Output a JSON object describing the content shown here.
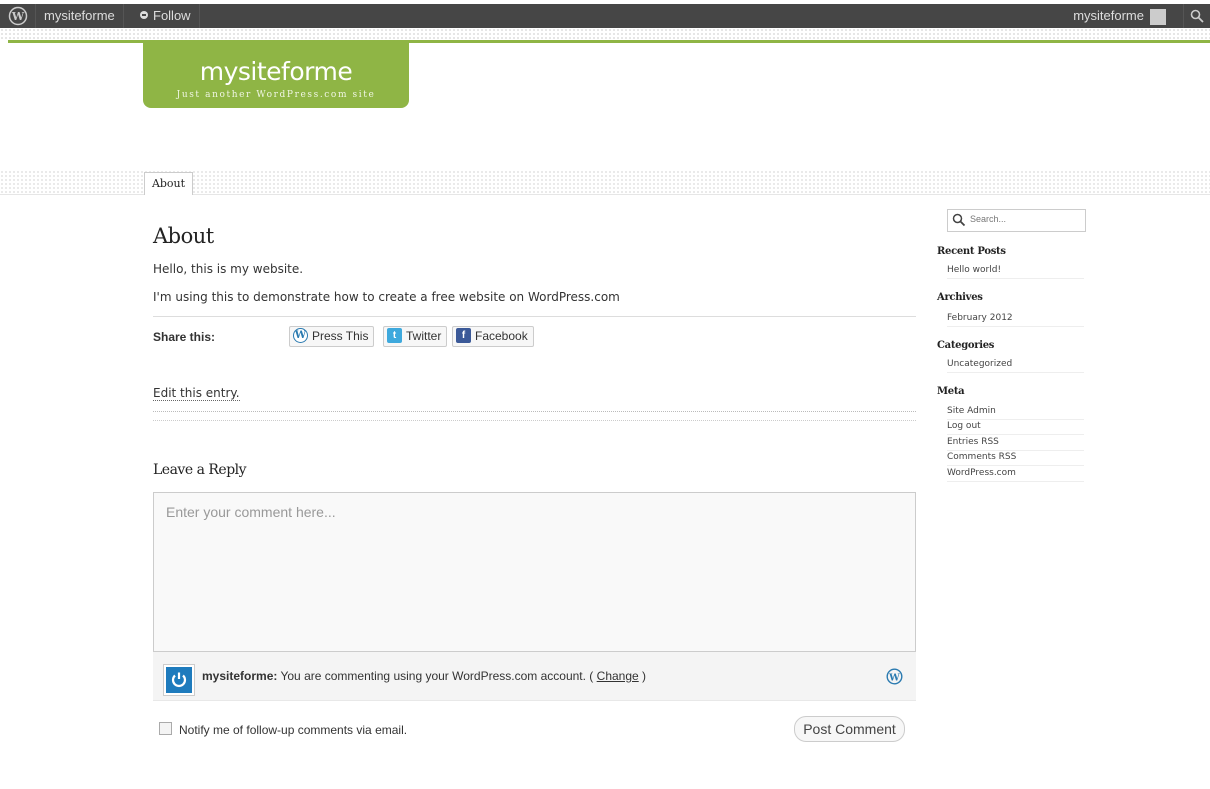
{
  "adminbar": {
    "site_name": "mysiteforme",
    "follow_label": "Follow",
    "user_name": "mysiteforme"
  },
  "header": {
    "title": "mysiteforme",
    "tagline": "Just another WordPress.com site"
  },
  "nav": {
    "tabs": [
      {
        "label": "About"
      }
    ]
  },
  "page": {
    "title": "About",
    "paragraphs": [
      "Hello, this is my website.",
      "I'm using this to demonstrate how to create a free website on WordPress.com"
    ]
  },
  "share": {
    "label": "Share this:",
    "buttons": [
      {
        "label": "Press This",
        "icon": "wordpress-icon"
      },
      {
        "label": "Twitter",
        "icon": "twitter-icon"
      },
      {
        "label": "Facebook",
        "icon": "facebook-icon"
      }
    ]
  },
  "edit_link": "Edit this entry.",
  "reply": {
    "title": "Leave a Reply",
    "placeholder": "Enter your comment here...",
    "identity_name": "mysiteforme:",
    "identity_text": "You are commenting using your WordPress.com account. (",
    "change_label": "Change",
    "identity_close": ")",
    "notify_label": "Notify me of follow-up comments via email.",
    "post_button": "Post Comment"
  },
  "sidebar": {
    "search_placeholder": "Search...",
    "widgets": [
      {
        "title": "Recent Posts",
        "items": [
          "Hello world!"
        ]
      },
      {
        "title": "Archives",
        "items": [
          "February 2012"
        ]
      },
      {
        "title": "Categories",
        "items": [
          "Uncategorized"
        ]
      },
      {
        "title": "Meta",
        "items": [
          "Site Admin",
          "Log out",
          "Entries RSS",
          "Comments RSS",
          "WordPress.com"
        ]
      }
    ]
  },
  "colors": {
    "accent": "#8fb545",
    "adminbar": "#464646"
  }
}
